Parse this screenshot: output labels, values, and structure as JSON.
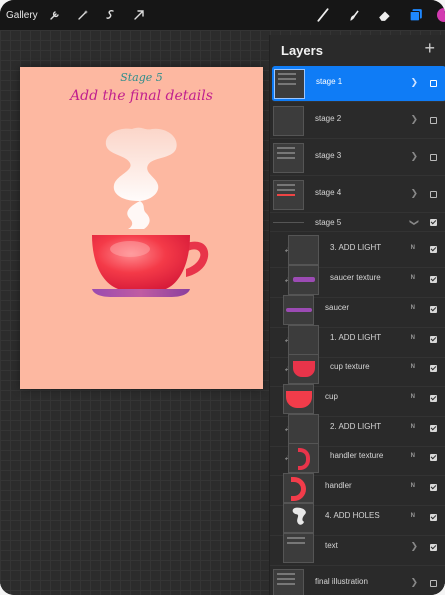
{
  "toolbar": {
    "gallery_label": "Gallery",
    "left_icons": [
      "wrench-icon",
      "magic-wand-icon",
      "selection-icon",
      "transform-arrow-icon"
    ],
    "right_icons": [
      "brush-icon",
      "smudge-icon",
      "eraser-icon",
      "layers-icon"
    ],
    "current_color": "#d23ab0"
  },
  "canvas": {
    "stage_label": "Stage 5",
    "headline": "Add the final details",
    "background_color": "#fdb8a1"
  },
  "layers_panel": {
    "title": "Layers",
    "add_label": "+",
    "layers": [
      {
        "name": "stage 1",
        "type": "group",
        "collapsed": true,
        "visible": false,
        "selected": true
      },
      {
        "name": "stage 2",
        "type": "group",
        "collapsed": true,
        "visible": false
      },
      {
        "name": "stage 3",
        "type": "group",
        "collapsed": true,
        "visible": false
      },
      {
        "name": "stage 4",
        "type": "group",
        "collapsed": true,
        "visible": false
      },
      {
        "name": "stage 5",
        "type": "group",
        "collapsed": false,
        "visible": true
      },
      {
        "name": "3. ADD LIGHT",
        "blend": "N",
        "visible": true,
        "clipped": true
      },
      {
        "name": "saucer texture",
        "blend": "N",
        "visible": true,
        "clipped": true
      },
      {
        "name": "saucer",
        "blend": "N",
        "visible": true
      },
      {
        "name": "1. ADD LIGHT",
        "blend": "N",
        "visible": true,
        "clipped": true
      },
      {
        "name": "cup texture",
        "blend": "N",
        "visible": true,
        "clipped": true
      },
      {
        "name": "cup",
        "blend": "N",
        "visible": true
      },
      {
        "name": "2. ADD LIGHT",
        "blend": "N",
        "visible": true,
        "clipped": true
      },
      {
        "name": "handler texture",
        "blend": "N",
        "visible": true,
        "clipped": true
      },
      {
        "name": "handler",
        "blend": "N",
        "visible": true
      },
      {
        "name": "4. ADD HOLES",
        "blend": "N",
        "visible": true
      },
      {
        "name": "text",
        "type": "group",
        "collapsed": true,
        "visible": true
      },
      {
        "name": "final illustration",
        "type": "group",
        "collapsed": true,
        "visible": false
      }
    ]
  }
}
